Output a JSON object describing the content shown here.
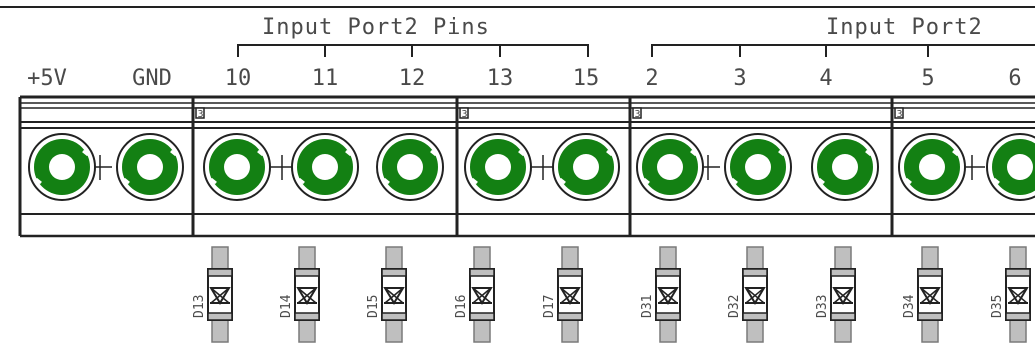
{
  "colors": {
    "copper": "#138013",
    "outline": "#222222",
    "text": "#4a4a4a",
    "diode_body": "#bfbfbf",
    "diode_frame": "#7a7a7a"
  },
  "groups": [
    {
      "label": "Input Port2 Pins"
    },
    {
      "label": "Input Port2"
    }
  ],
  "pin_labels": [
    "+5V",
    "GND",
    "10",
    "11",
    "12",
    "13",
    "15",
    "2",
    "3",
    "4",
    "5",
    "6"
  ],
  "block_marks": [
    "3",
    "3",
    "3",
    "3"
  ],
  "diodes": [
    "D13",
    "D14",
    "D15",
    "D16",
    "D17",
    "D31",
    "D32",
    "D33",
    "D34",
    "D35"
  ]
}
